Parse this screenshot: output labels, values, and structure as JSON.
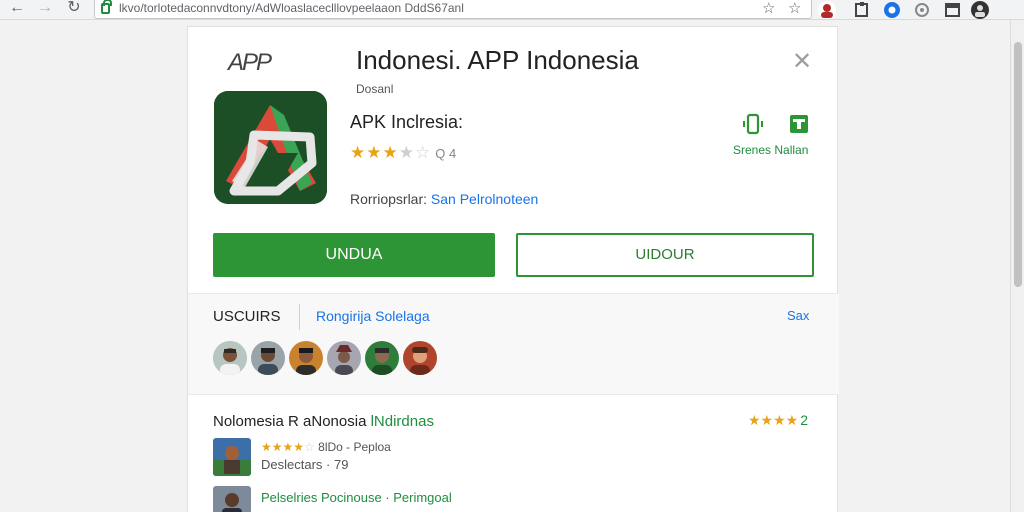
{
  "browser": {
    "url_highlight": "https://",
    "url": "lkvo/torlotedaconnvdtony/AdWloaslaceclllovpeelaaon DddS67anl",
    "icons": [
      "back-icon",
      "forward-icon",
      "reload-icon",
      "lock-icon",
      "star-icon",
      "bookmark-icon",
      "profile-icon",
      "extension-icon",
      "chrome-icon",
      "settings-icon",
      "window-icon",
      "avatar-icon"
    ]
  },
  "card": {
    "brand": "APP",
    "title": "Indonesi. APP Indonesia",
    "subtitle": "Dosanl",
    "close_glyph": "✕",
    "app": {
      "name": "APK Inclresia:",
      "rating_stars": 3,
      "rating_max": 5,
      "rating_text": "Q 4",
      "developer_label": "Rorriopsrlar:",
      "developer_link": "San Pelrolnoteen"
    },
    "share_label": "Srenes Nallan",
    "primary_button": "UNDUA",
    "secondary_button": "UIDOUR"
  },
  "users_section": {
    "label": "USCUIRS",
    "link": "Rongirija Solelaga",
    "see_all": "Sax"
  },
  "reviews": {
    "title_dark": "Nolomesia R aNonosia",
    "title_green": "lNdirdnas",
    "score_stars": 4,
    "score_num": "2",
    "items": [
      {
        "line1_text": "8lDo - Peploa",
        "line1_stars": 4,
        "line2": "Deslectars · 79"
      },
      {
        "name": "Pelselries Pocinouse · Perimgoal"
      }
    ]
  },
  "colors": {
    "accent_green": "#2e9537",
    "link_blue": "#1a73e8",
    "star": "#e8a317"
  }
}
